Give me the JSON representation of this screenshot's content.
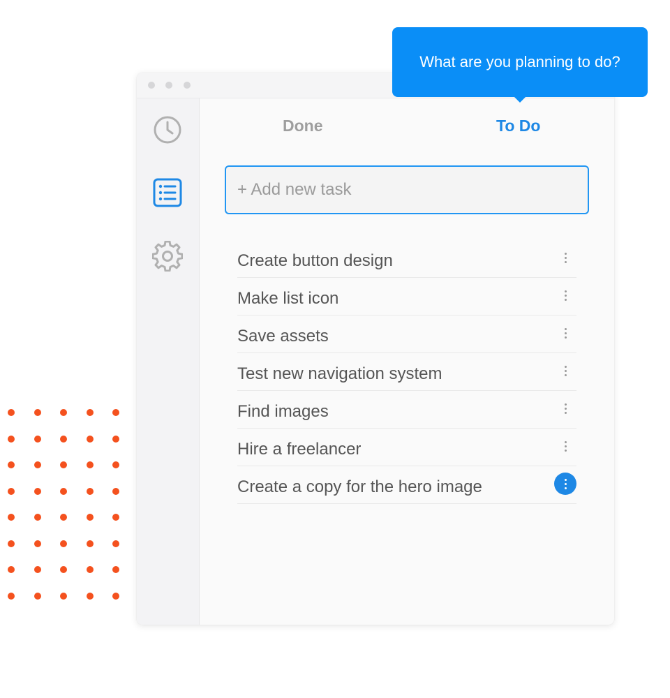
{
  "tooltip": {
    "text": "What are you planning to do?"
  },
  "tabs": {
    "done": "Done",
    "todo": "To Do",
    "active": "todo"
  },
  "add_task": {
    "placeholder": "+ Add new task",
    "value": ""
  },
  "sidebar": {
    "items": [
      {
        "icon": "clock-icon",
        "active": false
      },
      {
        "icon": "list-icon",
        "active": true
      },
      {
        "icon": "gear-icon",
        "active": false
      }
    ]
  },
  "tasks": [
    {
      "label": "Create button design",
      "menu_active": false
    },
    {
      "label": "Make list icon",
      "menu_active": false
    },
    {
      "label": "Save assets",
      "menu_active": false
    },
    {
      "label": "Test new navigation system",
      "menu_active": false
    },
    {
      "label": "Find images",
      "menu_active": false
    },
    {
      "label": "Hire a freelancer",
      "menu_active": false
    },
    {
      "label": "Create a copy for the hero image",
      "menu_active": true
    }
  ],
  "colors": {
    "accent": "#1e88e5",
    "tooltip": "#0a8ef7",
    "dots": "#f4511e",
    "inactive_icon": "#b0b0b0"
  }
}
